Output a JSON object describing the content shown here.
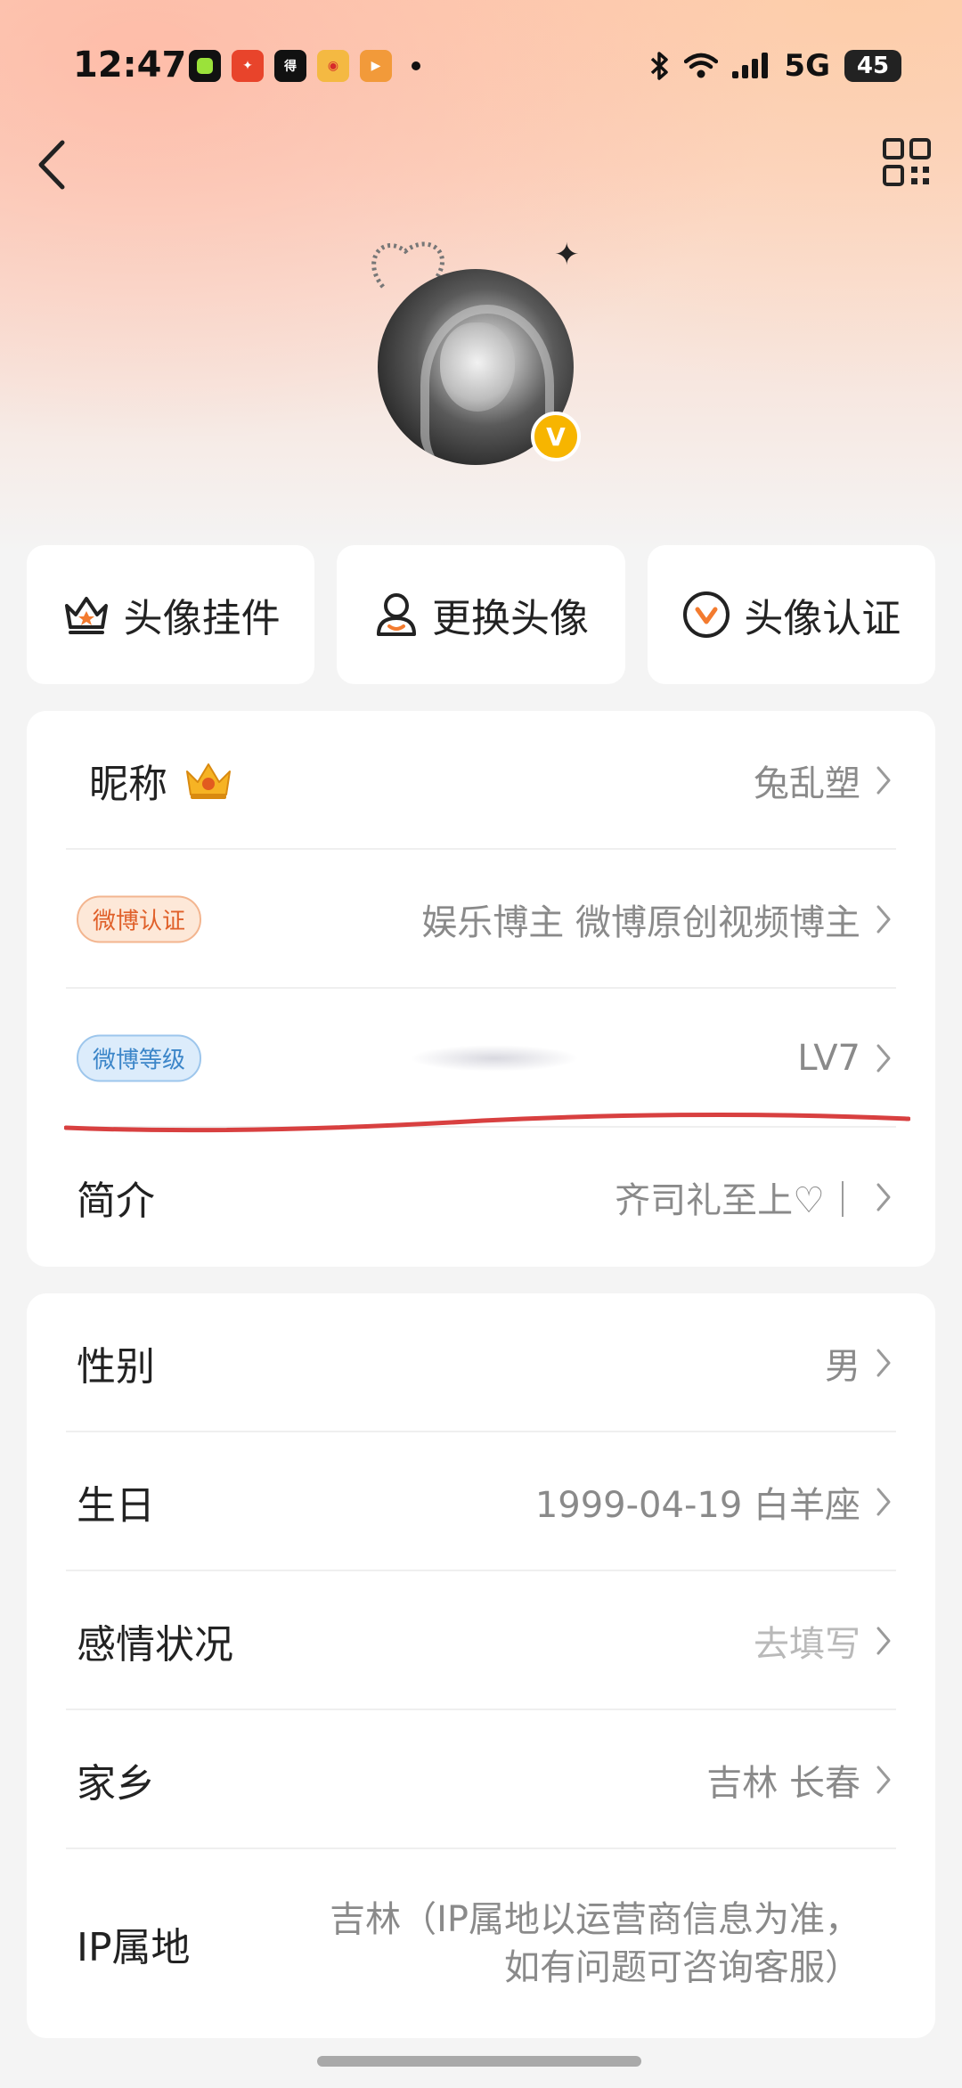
{
  "status_bar": {
    "time": "12:47",
    "apps": [
      {
        "name": "green-app-icon",
        "color": "#111111",
        "glyph": ""
      },
      {
        "name": "red-app-icon",
        "color": "#e8442b",
        "glyph": "✦"
      },
      {
        "name": "news-app-icon",
        "color": "#111111",
        "glyph": "得"
      },
      {
        "name": "weibo-app-icon",
        "color": "#f4b942",
        "glyph": "◉"
      },
      {
        "name": "video-app-icon",
        "color": "#f29a3a",
        "glyph": "▶"
      }
    ],
    "network": "5G",
    "battery": "45"
  },
  "actions": [
    {
      "name": "avatar-pendant-button",
      "label": "头像挂件",
      "icon": "crown-icon"
    },
    {
      "name": "change-avatar-button",
      "label": "更换头像",
      "icon": "person-icon"
    },
    {
      "name": "avatar-verify-button",
      "label": "头像认证",
      "icon": "verify-v-icon"
    }
  ],
  "profile": {
    "nickname_label": "昵称",
    "nickname_value": "兔乱塑",
    "verify_tag": "微博认证",
    "verify_value": "娱乐博主 微博原创视频博主",
    "level_tag": "微博等级",
    "level_value": "LV7",
    "bio_label": "简介",
    "bio_value": "齐司礼至上♡｜"
  },
  "details": {
    "gender_label": "性别",
    "gender_value": "男",
    "birthday_label": "生日",
    "birthday_value": "1999-04-19 白羊座",
    "relationship_label": "感情状况",
    "relationship_value": "去填写",
    "hometown_label": "家乡",
    "hometown_value": "吉林 长春",
    "ip_label": "IP属地",
    "ip_value_line1": "吉林（IP属地以运营商信息为准，",
    "ip_value_line2": "如有问题可咨询客服）"
  },
  "colors": {
    "accent_orange": "#f37b2f",
    "verified_gold": "#f7b500",
    "annotation_red": "#d84040"
  }
}
